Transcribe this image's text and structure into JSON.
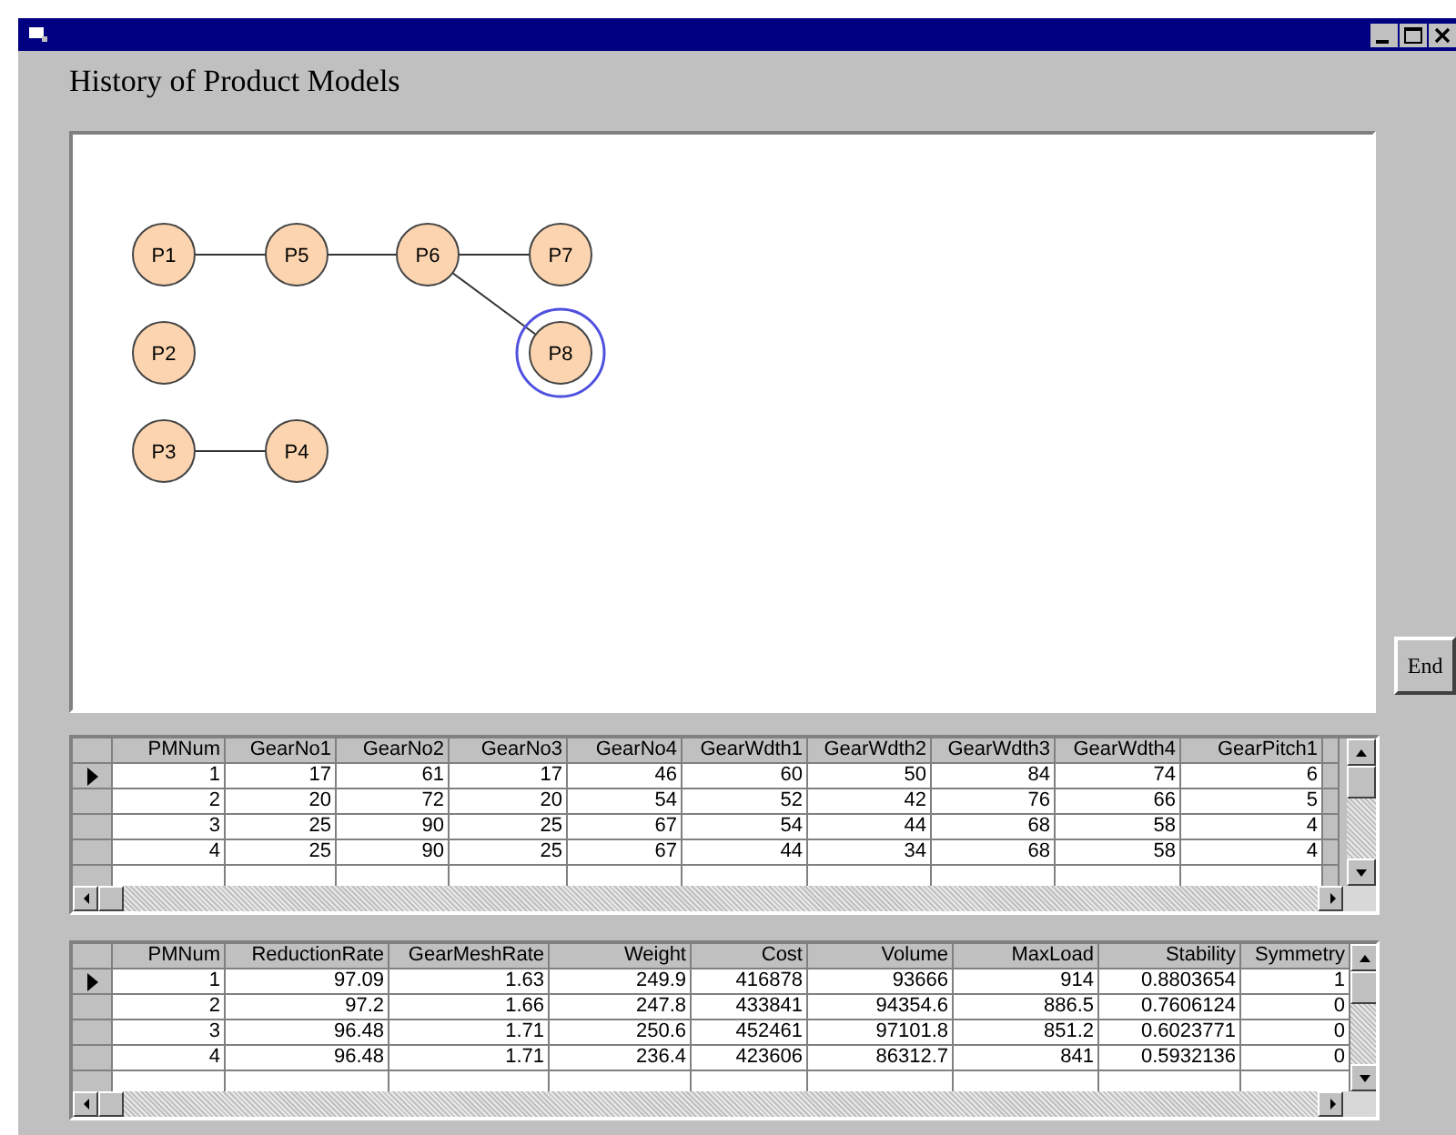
{
  "window": {
    "title": "History of Product Models"
  },
  "graph": {
    "nodes": [
      {
        "label": "P1",
        "selected": false
      },
      {
        "label": "P5",
        "selected": false
      },
      {
        "label": "P6",
        "selected": false
      },
      {
        "label": "P7",
        "selected": false
      },
      {
        "label": "P2",
        "selected": false
      },
      {
        "label": "P8",
        "selected": true
      },
      {
        "label": "P3",
        "selected": false
      },
      {
        "label": "P4",
        "selected": false
      }
    ]
  },
  "end_button": "End",
  "grids": [
    {
      "columns": [
        "PMNum",
        "GearNo1",
        "GearNo2",
        "GearNo3",
        "GearNo4",
        "GearWdth1",
        "GearWdth2",
        "GearWdth3",
        "GearWdth4",
        "GearPitch1"
      ],
      "rows": [
        {
          "selected": true,
          "cells": [
            "1",
            "17",
            "61",
            "17",
            "46",
            "60",
            "50",
            "84",
            "74",
            "6"
          ]
        },
        {
          "selected": false,
          "cells": [
            "2",
            "20",
            "72",
            "20",
            "54",
            "52",
            "42",
            "76",
            "66",
            "5"
          ]
        },
        {
          "selected": false,
          "cells": [
            "3",
            "25",
            "90",
            "25",
            "67",
            "54",
            "44",
            "68",
            "58",
            "4"
          ]
        },
        {
          "selected": false,
          "cells": [
            "4",
            "25",
            "90",
            "25",
            "67",
            "44",
            "34",
            "68",
            "58",
            "4"
          ]
        }
      ]
    },
    {
      "columns": [
        "PMNum",
        "ReductionRate",
        "GearMeshRate",
        "Weight",
        "Cost",
        "Volume",
        "MaxLoad",
        "Stability",
        "Symmetry"
      ],
      "rows": [
        {
          "selected": true,
          "cells": [
            "1",
            "97.09",
            "1.63",
            "249.9",
            "416878",
            "93666",
            "914",
            "0.8803654",
            "1"
          ]
        },
        {
          "selected": false,
          "cells": [
            "2",
            "97.2",
            "1.66",
            "247.8",
            "433841",
            "94354.6",
            "886.5",
            "0.7606124",
            "0"
          ]
        },
        {
          "selected": false,
          "cells": [
            "3",
            "96.48",
            "1.71",
            "250.6",
            "452461",
            "97101.8",
            "851.2",
            "0.6023771",
            "0"
          ]
        },
        {
          "selected": false,
          "cells": [
            "4",
            "96.48",
            "1.71",
            "236.4",
            "423606",
            "86312.7",
            "841",
            "0.5932136",
            "0"
          ]
        }
      ]
    }
  ]
}
